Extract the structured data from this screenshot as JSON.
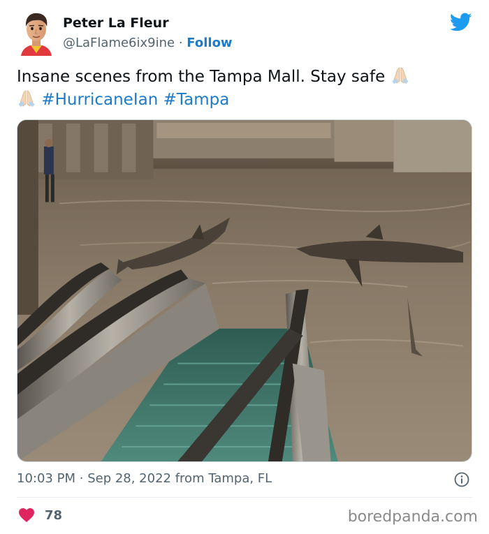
{
  "author": {
    "name": "Peter La Fleur",
    "handle": "@LaFlame6ix9ine",
    "separator": "·",
    "follow_label": "Follow"
  },
  "tweet": {
    "text_main": "Insane scenes from the Tampa Mall. Stay safe",
    "hashtags": [
      "#HurricaneIan",
      "#Tampa"
    ],
    "emoji": "folded-hands"
  },
  "meta": {
    "time": "10:03 PM",
    "separator": "·",
    "date_location": "Sep 28, 2022 from Tampa, FL"
  },
  "engagement": {
    "likes": "78"
  },
  "watermark": "boredpanda.com",
  "colors": {
    "link": "#1d7bc8",
    "twitter_blue": "#1d9bf0",
    "heart": "#e0245e",
    "muted": "#536471"
  },
  "icons": {
    "logo": "twitter-bird-icon",
    "info": "info-icon",
    "like": "heart-icon"
  }
}
